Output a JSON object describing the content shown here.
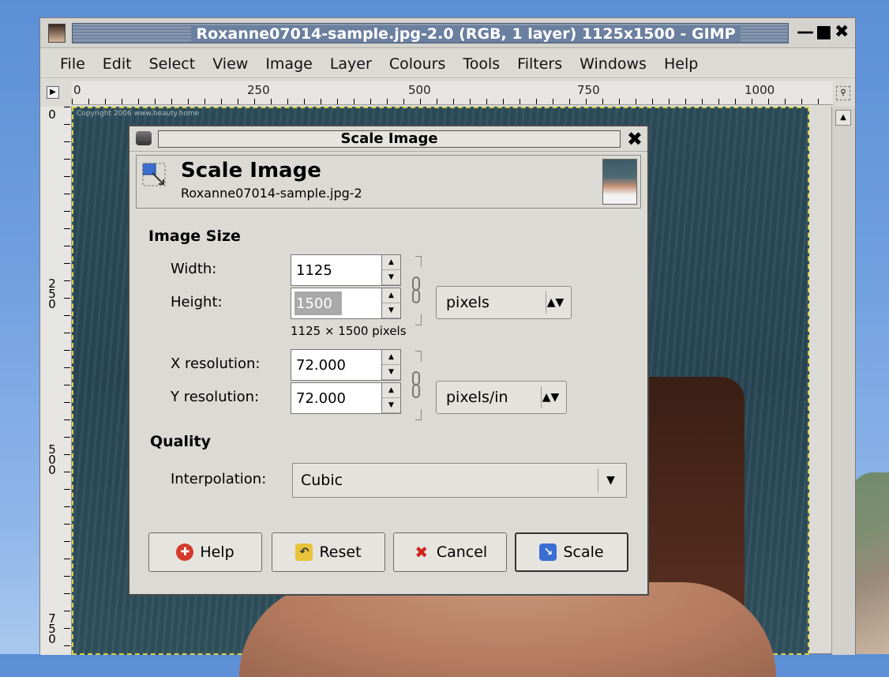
{
  "window": {
    "title": "Roxanne07014-sample.jpg-2.0 (RGB, 1 layer) 1125x1500 - GIMP",
    "wm_minimize": "—",
    "wm_maximize": "■",
    "wm_close": "✖"
  },
  "menubar": {
    "items": [
      "File",
      "Edit",
      "Select",
      "View",
      "Image",
      "Layer",
      "Colours",
      "Tools",
      "Filters",
      "Windows",
      "Help"
    ]
  },
  "ruler_top": {
    "labels": [
      "0",
      "250",
      "500",
      "750",
      "1000"
    ]
  },
  "ruler_left": {
    "labels": [
      "0",
      "250",
      "500",
      "750"
    ]
  },
  "canvas": {
    "copyright": "Copyright 2006 www.beauty.home"
  },
  "dialog": {
    "title": "Scale Image",
    "header_title": "Scale Image",
    "header_subtitle": "Roxanne07014-sample.jpg-2",
    "image_size_label": "Image Size",
    "width_label": "Width:",
    "width_value": "1125",
    "height_label": "Height:",
    "height_value": "1500",
    "size_unit": "pixels",
    "dimensions_text": "1125 × 1500 pixels",
    "xres_label": "X resolution:",
    "xres_value": "72.000",
    "yres_label": "Y resolution:",
    "yres_value": "72.000",
    "res_unit": "pixels/in",
    "quality_label": "Quality",
    "interp_label": "Interpolation:",
    "interp_value": "Cubic",
    "buttons": {
      "help": "Help",
      "reset": "Reset",
      "cancel": "Cancel",
      "scale": "Scale"
    }
  },
  "colors": {
    "title_bar": "#6b7f9f",
    "canvas_bg": "#2d4d5c",
    "dialog_bg": "#dcdad5"
  }
}
